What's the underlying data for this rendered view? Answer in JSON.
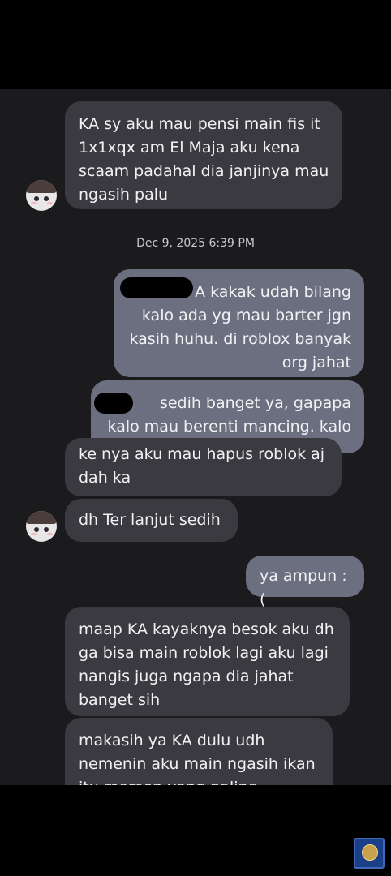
{
  "conversation": {
    "timestamp": "Dec 9, 2025 6:39 PM",
    "messages": [
      {
        "id": "m1",
        "direction": "incoming",
        "text": "KA sy aku mau pensi main fis it\n1x1xqx am El Maja aku kena\nscaam padahal dia janjinya mau\nngasih palu"
      },
      {
        "id": "m2",
        "direction": "outgoing",
        "text": "A kakak udah bilang\nkalo ada yg mau barter jgn\nkasih huhu. di roblox banyak\norg jahat",
        "redacted_prefix": true
      },
      {
        "id": "m3",
        "direction": "outgoing",
        "text": "sedih banget ya, gapapa\nkalo mau berenti mancing. kalo",
        "redacted_prefix": true
      },
      {
        "id": "m4",
        "direction": "incoming",
        "text": "ke nya aku mau hapus roblok aj\ndah ka"
      },
      {
        "id": "m5",
        "direction": "incoming",
        "text": "dh Ter lanjut sedih"
      },
      {
        "id": "m6",
        "direction": "outgoing",
        "text": "ya ampun :("
      },
      {
        "id": "m7",
        "direction": "incoming",
        "text": "maap KA kayaknya besok aku dh\nga bisa main roblok lagi  aku lagi\nnangis juga ngapa dia jahat\nbanget sih"
      },
      {
        "id": "m8",
        "direction": "incoming",
        "text": "makasih ya KA dulu udh\nnemenin aku main ngasih ikan\nitu momen yang paling"
      }
    ]
  },
  "colors": {
    "page_background": "#000000",
    "chat_background": "#1b1b1e",
    "incoming_bubble": "#3a3a40",
    "outgoing_bubble": "#6b6f80",
    "text": "#f2f2f4"
  },
  "icons": {
    "contact_avatar": "avatar-icon",
    "watermark": "logo-icon"
  }
}
